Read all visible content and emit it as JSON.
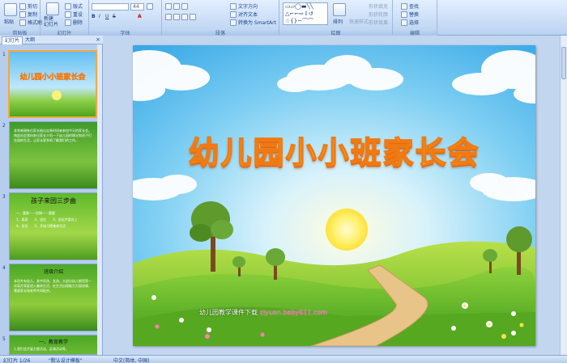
{
  "ribbon": {
    "clipboard": {
      "label": "剪贴板",
      "paste": "粘贴",
      "cut": "剪切",
      "copy": "复制",
      "format_painter": "格式刷"
    },
    "slides": {
      "label": "幻灯片",
      "new_slide": "新建\n幻灯片",
      "layout": "版式",
      "reset": "重设",
      "delete": "删除"
    },
    "font": {
      "label": "字体",
      "font_name": "",
      "font_size": "44"
    },
    "paragraph": {
      "label": "段落",
      "text_direction": "文字方向",
      "align_text": "对齐文本",
      "smartart": "转换为 SmartArt"
    },
    "drawing": {
      "label": "绘图",
      "arrange": "排列",
      "quick_styles": "快速样式",
      "shape_fill": "形状填充",
      "shape_outline": "形状轮廓",
      "shape_effects": "形状效果"
    },
    "editing": {
      "label": "编辑",
      "find": "查找",
      "replace": "替换",
      "select": "选择"
    }
  },
  "pane": {
    "tabs": [
      "幻灯片",
      "大纲"
    ],
    "close": "×",
    "slides": [
      {
        "num": "1",
        "title": "幼儿园小小班家长会"
      },
      {
        "num": "2",
        "text": "非常感谢各位家长抽出宝贵时间来参加今天的家长会。借此机会我向各位家长介绍一下幼儿园的情况和孩子们在园的生活，让家长更多地了解我们的工作。"
      },
      {
        "num": "3",
        "title": "孩子来园三步曲",
        "lines": [
          "一、重要——恐惧——重要",
          "1、离家　　2、适应　　3、适应并喜欢上",
          "4、信任　　5、开始习惯集体生活"
        ]
      },
      {
        "num": "4",
        "title": "班级介绍",
        "text": "本班共有幼儿，其中男孩，女孩。大部分幼儿都是第一次离开家庭进入集体生活，在生活自理能力方面较弱，需要家长和老师共同配合。"
      },
      {
        "num": "5",
        "title": "一、教育教学",
        "text": "1.我们会开展主题活动、区域活动等。"
      }
    ]
  },
  "slide": {
    "title": "幼儿园小小班家长会",
    "footer_prefix": "幼儿园教学课件下载",
    "footer_url": "ziyuan.baby611.com"
  },
  "status": {
    "slide_info": "幻灯片 1/26",
    "theme": "\"默认设计模板\"",
    "language": "中文(简体, 中国)"
  },
  "colors": {
    "title_fill": "#ffc21c",
    "title_stroke": "#f07a12",
    "ribbon": "#c7dbf5",
    "pane": "#b7cdee"
  }
}
